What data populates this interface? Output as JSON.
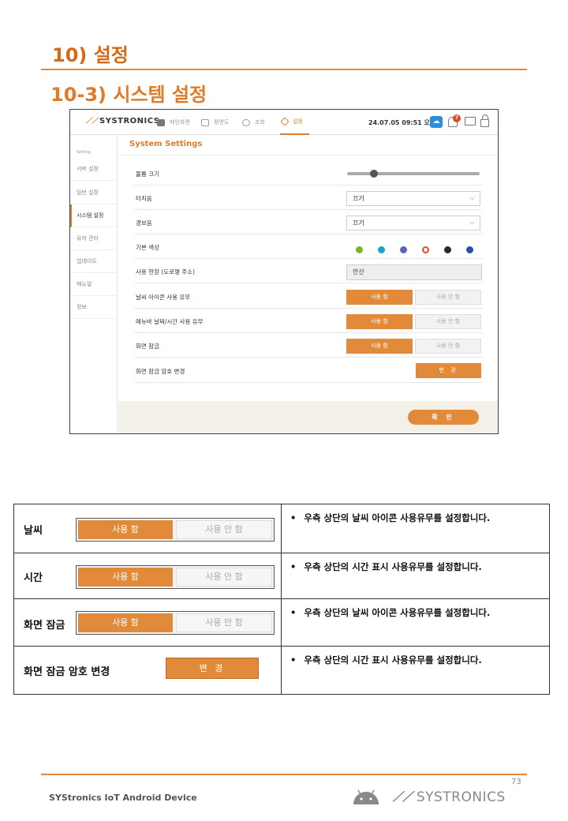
{
  "heading1": "10) 설정",
  "heading2": "10-3)  시스템 설정",
  "app": {
    "logo": "SYSTRONICS",
    "nav": [
      "메인화면",
      "평면도",
      "조회",
      "설정"
    ],
    "datetime": "24.07.05 09:51 오전",
    "notification_count": "7",
    "sidebar_title": "Setting",
    "sidebar": [
      "서버 설정",
      "일반 설정",
      "시스템 설정",
      "유저 관리",
      "업데이트",
      "매뉴얼",
      "정보"
    ],
    "active_sidebar": "시스템 설정",
    "title": "System Settings",
    "rows": {
      "volume": "볼륨 크기",
      "touch_sound": "터치음",
      "alarm_sound": "경보음",
      "base_color": "기본 색상",
      "site": "사용 현장 (도로명 주소)",
      "weather_icon": "날씨 아이콘 사용 유무",
      "menubar_datetime": "메뉴바 날짜/시간 사용 유무",
      "screen_lock": "화면 잠금",
      "lock_password": "화면 잠금 암호 변경"
    },
    "volume_level": 0.2,
    "touch_value": "끄기",
    "alarm_value": "끄기",
    "site_value": "안산",
    "colors": [
      "#7db52a",
      "#1aa3c9",
      "#5a64b8",
      "#e04a2a",
      "#2a2a2a",
      "#2a4fa8"
    ],
    "selected_color_index": 3,
    "use_label": "사용 함",
    "nouse_label": "사용 안 함",
    "change_label": "변 경",
    "confirm_label": "확 인"
  },
  "table": [
    {
      "label": "날씨",
      "on": "사용 함",
      "off": "사용 안 함",
      "bullet": "•",
      "desc": "우측 상단의 날씨 아이콘 사용유무를 설정합니다."
    },
    {
      "label": "시간",
      "on": "사용 함",
      "off": "사용 안 함",
      "bullet": "•",
      "desc": "우측 상단의 시간 표시 사용유무를 설정합니다."
    },
    {
      "label": "화면 잠금",
      "on": "사용 함",
      "off": "사용 안 함",
      "bullet": "•",
      "desc": "우측 상단의 날씨 아이콘 사용유무를 설정합니다."
    },
    {
      "label": "화면 잠금 암호 변경",
      "button": "변 경",
      "bullet": "•",
      "desc": "우측 상단의 시간 표시 사용유무를 설정합니다."
    }
  ],
  "footer": {
    "page": "73",
    "left": "SYStronics IoT Android Device",
    "logo": "SYSTRONICS"
  }
}
